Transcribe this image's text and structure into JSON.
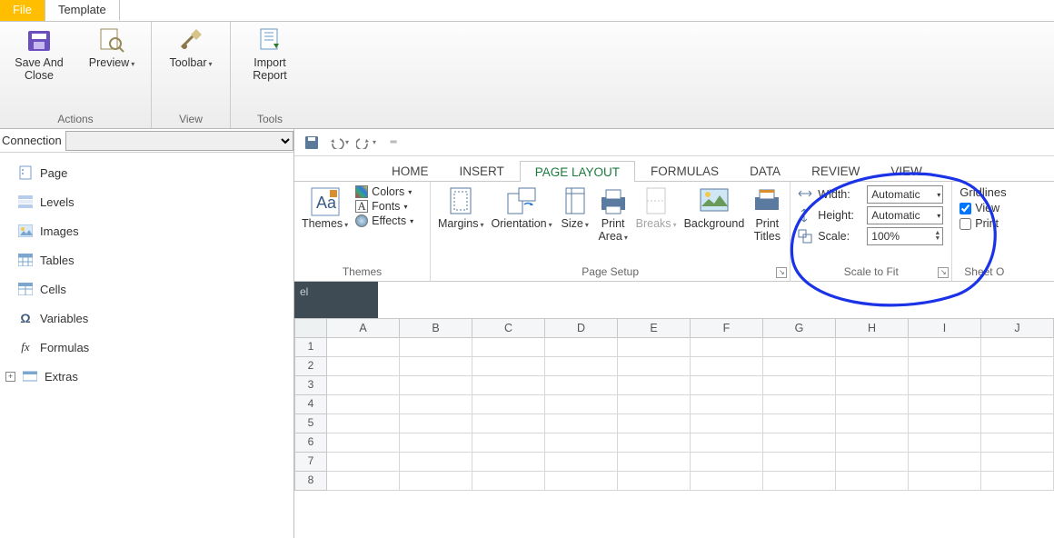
{
  "outer": {
    "tabs": {
      "file": "File",
      "template": "Template"
    },
    "groups": {
      "actions": {
        "label": "Actions",
        "saveClose": "Save And\nClose",
        "preview": "Preview"
      },
      "view": {
        "label": "View",
        "toolbar": "Toolbar"
      },
      "tools": {
        "label": "Tools",
        "import": "Import\nReport"
      }
    }
  },
  "left": {
    "connection_label": "Connection",
    "items": [
      "Page",
      "Levels",
      "Images",
      "Tables",
      "Cells",
      "Variables",
      "Formulas",
      "Extras"
    ]
  },
  "excel": {
    "tabs": [
      "HOME",
      "INSERT",
      "PAGE LAYOUT",
      "FORMULAS",
      "DATA",
      "REVIEW",
      "VIEW"
    ],
    "active_tab": "PAGE LAYOUT",
    "themes": {
      "label": "Themes",
      "themes": "Themes",
      "colors": "Colors",
      "fonts": "Fonts",
      "effects": "Effects"
    },
    "pagesetup": {
      "label": "Page Setup",
      "margins": "Margins",
      "orientation": "Orientation",
      "size": "Size",
      "printarea": "Print\nArea",
      "breaks": "Breaks",
      "background": "Background",
      "printtitles": "Print\nTitles"
    },
    "scale": {
      "label": "Scale to Fit",
      "width": "Width:",
      "height": "Height:",
      "scale": "Scale:",
      "auto": "Automatic",
      "pct": "100%"
    },
    "sheetopt": {
      "label": "Sheet O",
      "gridlines": "Gridlines",
      "view": "View",
      "print": "Print"
    },
    "dark_strip": "el",
    "columns": [
      "A",
      "B",
      "C",
      "D",
      "E",
      "F",
      "G",
      "H",
      "I",
      "J"
    ],
    "rows": [
      "1",
      "2",
      "3",
      "4",
      "5",
      "6",
      "7",
      "8"
    ]
  }
}
